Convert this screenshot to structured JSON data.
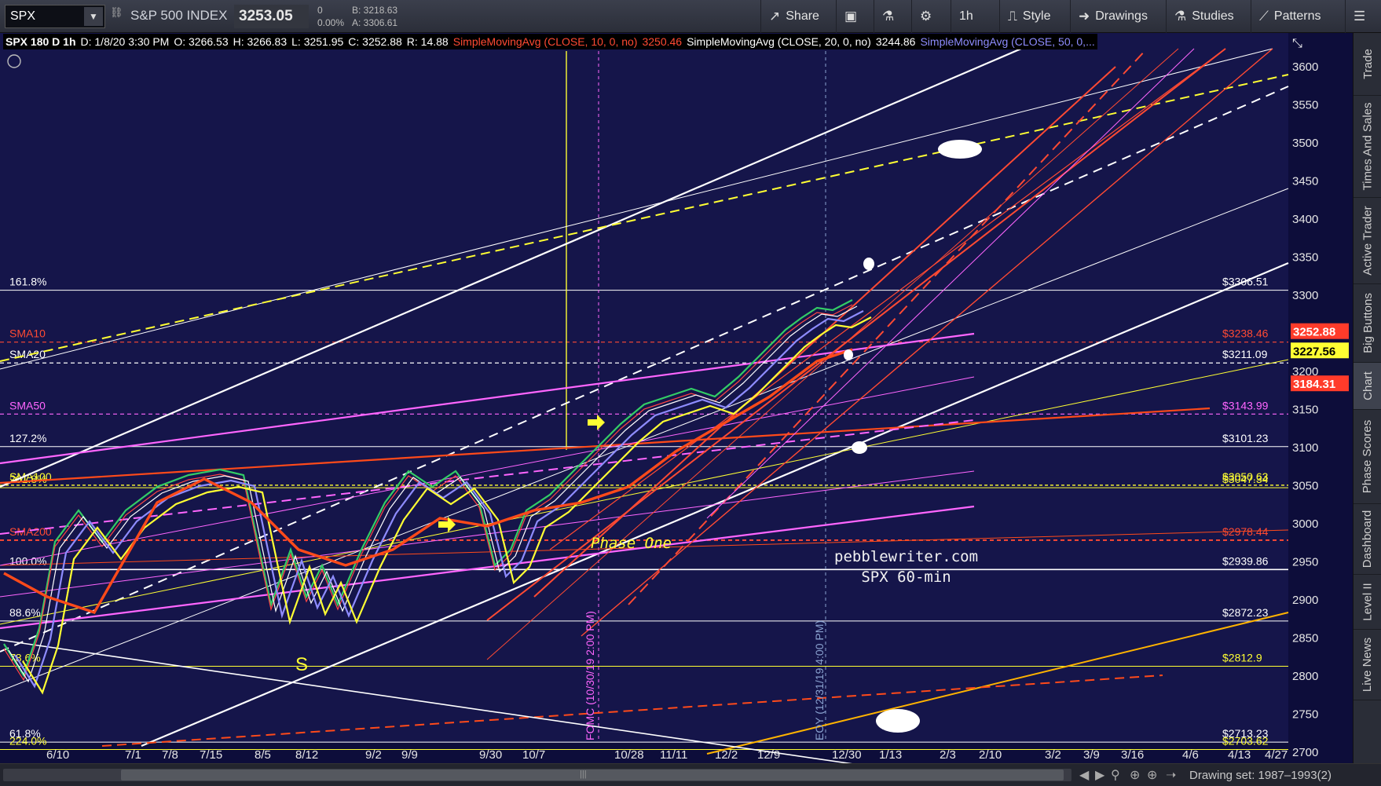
{
  "toolbar": {
    "symbol": "SPX",
    "index_name": "S&P 500 INDEX",
    "last": "3253.05",
    "change": "0",
    "change_pct": "0.00%",
    "bid": "B: 3218.63",
    "ask": "A: 3306.61",
    "share": "Share",
    "timeframe": "1h",
    "style": "Style",
    "drawings": "Drawings",
    "studies": "Studies",
    "patterns": "Patterns"
  },
  "header": {
    "title": "SPX 180 D 1h",
    "date": "D: 1/8/20 3:30 PM",
    "open": "O: 3266.53",
    "high": "H: 3266.83",
    "low": "L: 3251.95",
    "close": "C: 3252.88",
    "range": "R: 14.88",
    "sma10_label": "SimpleMovingAvg (CLOSE, 10, 0, no)",
    "sma10_value": "3250.46",
    "sma20_label": "SimpleMovingAvg (CLOSE, 20, 0, no)",
    "sma20_value": "3244.86",
    "sma50_label": "SimpleMovingAvg (CLOSE, 50, 0,..."
  },
  "price_axis": [
    "3600",
    "3550",
    "3500",
    "3450",
    "3400",
    "3350",
    "3300",
    "3250",
    "3200",
    "3150",
    "3100",
    "3050",
    "3000",
    "2950",
    "2900",
    "2850",
    "2800",
    "2750",
    "2700"
  ],
  "time_axis": [
    "6/10",
    "7/1",
    "7/8",
    "7/15",
    "8/5",
    "8/12",
    "9/2",
    "9/9",
    "9/30",
    "10/7",
    "10/28",
    "11/11",
    "12/2",
    "12/9",
    "12/30",
    "1/13",
    "2/3",
    "2/10",
    "3/2",
    "3/9",
    "3/16",
    "4/6",
    "4/13",
    "4/27"
  ],
  "levels": [
    {
      "left": "161.8%",
      "right": "$3306.51",
      "color": "#ffffff"
    },
    {
      "left": "SMA10",
      "right": "$3238.46",
      "color": "#ff4a33"
    },
    {
      "left": "SMA20",
      "right": "$3211.09",
      "color": "#ffffff"
    },
    {
      "left": "SMA50",
      "right": "$3143.99",
      "color": "#ff66ff"
    },
    {
      "left": "127.2%",
      "right": "$3101.23",
      "color": "#ffffff"
    },
    {
      "left": "SMA100",
      "right": "$3050.63",
      "color": "#ffff33"
    },
    {
      "left": "261.8%",
      "right": "$3047.34",
      "color": "#ffff33"
    },
    {
      "left": "SMA200",
      "right": "$2978.44",
      "color": "#ff4a33"
    },
    {
      "left": "100.0%",
      "right": "$2939.86",
      "color": "#ffffff"
    },
    {
      "left": "88.6%",
      "right": "$2872.23",
      "color": "#ffffff"
    },
    {
      "left": "78.6%",
      "right": "$2812.9",
      "color": "#ffff33"
    },
    {
      "left": "61.8%",
      "right": "$2713.23",
      "color": "#ffffff"
    },
    {
      "left": "224.0%",
      "right": "$2703.62",
      "color": "#ffff33"
    }
  ],
  "badges": [
    {
      "value": "3252.88",
      "bg": "#ff3b2a",
      "fg": "#ffffff"
    },
    {
      "value": "3227.56",
      "bg": "#ffff33",
      "fg": "#000000"
    },
    {
      "value": "3184.31",
      "bg": "#ff3b2a",
      "fg": "#ffffff"
    }
  ],
  "annotations": {
    "phase_one": "Phase One",
    "s_label": "S",
    "fomc": "FOMC (10/30/19 2:00 PM)",
    "eoy": "EOY (12/31/19 4:00 PM)",
    "site": "pebblewriter.com",
    "subtitle": "SPX 60-min"
  },
  "right_tabs": [
    "Trade",
    "Times And Sales",
    "Active Trader",
    "Big Buttons",
    "Chart",
    "Phase Scores",
    "Dashboard",
    "Level II",
    "Live News"
  ],
  "bottom": {
    "drawing_set": "Drawing set: 1987–1993(2)"
  },
  "colors": {
    "chart_bg": "#15154a",
    "sma10": "#ff4a33",
    "sma20": "#ffffff",
    "sma50": "#8e8cff",
    "sma100": "#ffff33",
    "sma200": "#ff4a1a",
    "fib": "#ffffff",
    "magenta": "#ff66ff",
    "orange": "#ffb300"
  }
}
